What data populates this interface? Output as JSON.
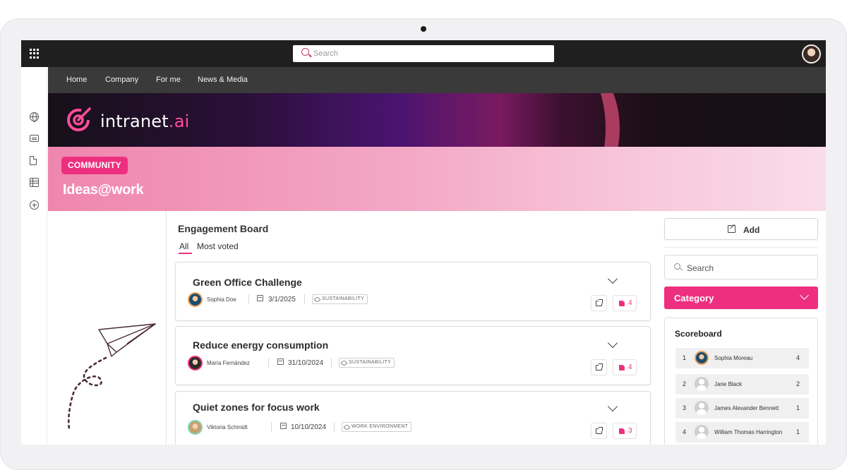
{
  "topbar": {
    "search_placeholder": "Search"
  },
  "nav": {
    "items": [
      "Home",
      "Company",
      "For me",
      "News & Media"
    ]
  },
  "banner": {
    "logo_text_main": "intranet",
    "logo_text_accent": ".ai"
  },
  "hero": {
    "badge": "COMMUNITY",
    "title": "Ideas@work"
  },
  "board": {
    "title": "Engagement Board",
    "tabs": [
      "All",
      "Most voted"
    ],
    "cards": [
      {
        "title": "Green Office Challenge",
        "author": "Sophia Doe",
        "date": "3/1/2025",
        "tag": "SUSTAINABILITY",
        "likes": "4"
      },
      {
        "title": "Reduce energy consumption",
        "author": "María Fernández",
        "date": "31/10/2024",
        "tag": "SUSTAINABILITY",
        "likes": "4"
      },
      {
        "title": "Quiet zones for focus work",
        "author": "Viktoria Schmidt",
        "date": "10/10/2024",
        "tag": "WORK ENVIRONMENT",
        "likes": "3"
      }
    ]
  },
  "sidebar_right": {
    "add_label": "Add",
    "search_placeholder": "Search",
    "category_label": "Category",
    "scoreboard": {
      "title": "Scoreboard",
      "rows": [
        {
          "rank": "1",
          "name": "Sophia Moreau",
          "score": "4"
        },
        {
          "rank": "2",
          "name": "Jane Black",
          "score": "2"
        },
        {
          "rank": "3",
          "name": "James Alexander Bennett",
          "score": "1"
        },
        {
          "rank": "4",
          "name": "William Thomas Harrington",
          "score": "1"
        }
      ]
    }
  },
  "colors": {
    "accent": "#ee2f7f",
    "topbar": "#1f1f1f",
    "nav": "#3a3a3a"
  }
}
